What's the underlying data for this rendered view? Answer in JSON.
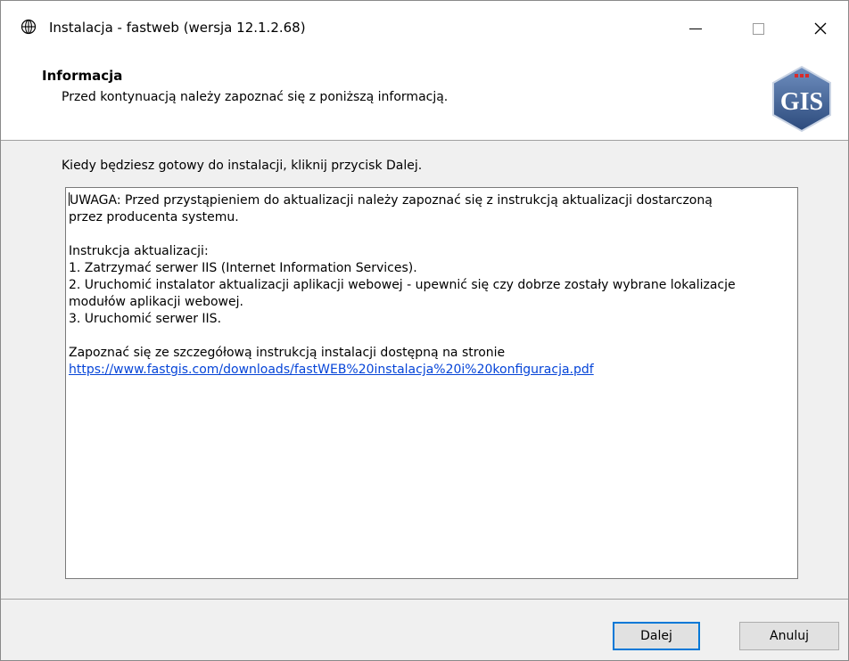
{
  "window": {
    "title": "Instalacja - fastweb (wersja 12.1.2.68)",
    "icon": "globe-icon",
    "controls": [
      "minimize",
      "maximize",
      "close"
    ]
  },
  "header": {
    "title": "Informacja",
    "subtitle": "Przed kontynuacją należy zapoznać się z poniższą informacją.",
    "logo_text": "GIS"
  },
  "body": {
    "instruction": "Kiedy będziesz gotowy do instalacji, kliknij przycisk Dalej.",
    "info_lines": [
      "UWAGA: Przed przystąpieniem do aktualizacji należy zapoznać się z instrukcją aktualizacji dostarczoną",
      "przez producenta systemu.",
      "",
      "Instrukcja aktualizacji:",
      "1. Zatrzymać serwer IIS (Internet Information Services).",
      "2. Uruchomić instalator aktualizacji aplikacji webowej - upewnić się czy dobrze zostały wybrane lokalizacje",
      "modułów aplikacji webowej.",
      "3. Uruchomić serwer IIS.",
      "",
      "Zapoznać się ze szczegółową instrukcją instalacji dostępną na stronie"
    ],
    "info_link": "https://www.fastgis.com/downloads/fastWEB%20instalacja%20i%20konfiguracja.pdf"
  },
  "buttons": {
    "next": "Dalej",
    "cancel": "Anuluj"
  },
  "colors": {
    "link": "#0645d8",
    "default_button_border": "#0078d7",
    "logo_blue": "#3a5a8c"
  }
}
